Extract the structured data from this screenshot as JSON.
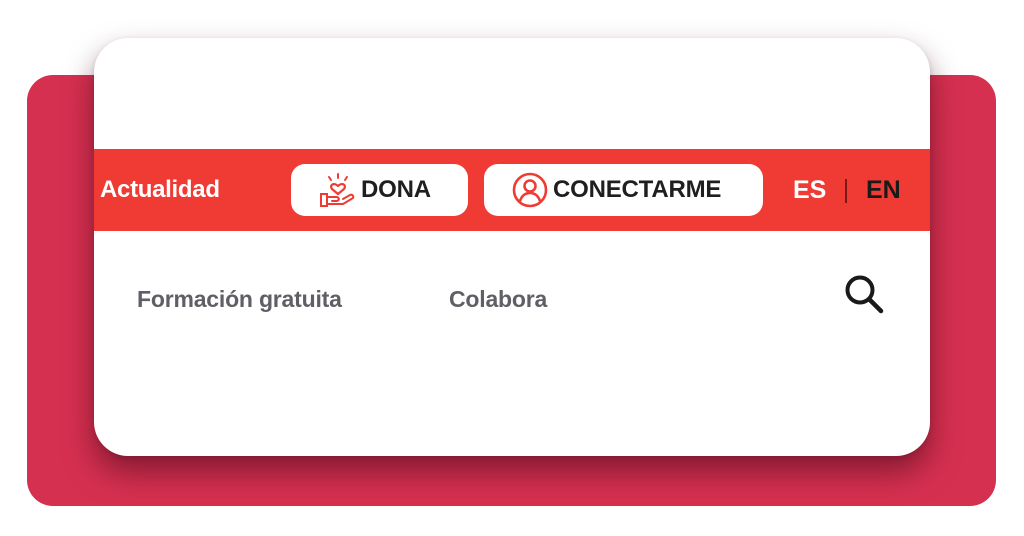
{
  "topbar": {
    "news_link": "Actualidad",
    "donate_label": "DONA",
    "connect_label": "CONECTARME",
    "lang_es": "ES",
    "lang_en": "EN"
  },
  "nav": {
    "items": [
      {
        "label": "Formación gratuita"
      },
      {
        "label": "Colabora"
      }
    ]
  },
  "icons": {
    "donate": "hand-heart-icon",
    "connect": "user-circle-icon",
    "search": "search-icon"
  },
  "colors": {
    "topbar": "#ef3b33",
    "back_card": "#d63050",
    "nav_text": "#5f5f66"
  }
}
